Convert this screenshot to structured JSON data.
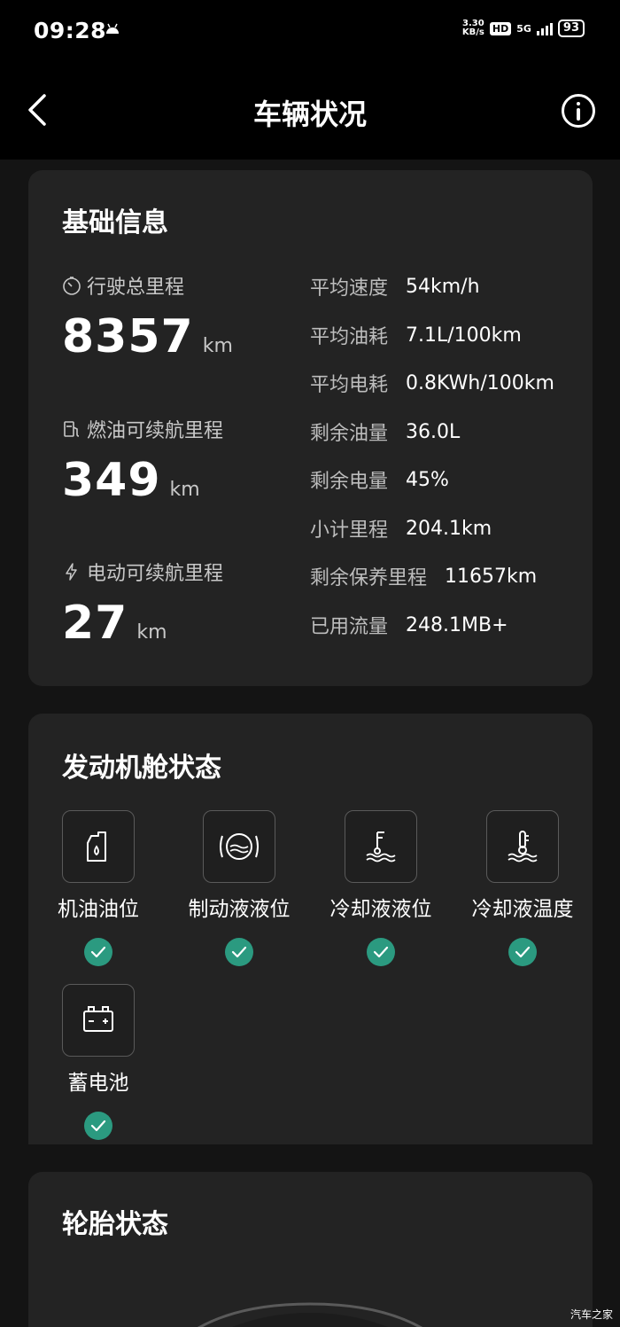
{
  "status_bar": {
    "time": "09:28",
    "net_speed_value": "3.30",
    "net_speed_unit": "KB/s",
    "hd_badge": "HD",
    "network": "5G",
    "battery": "93"
  },
  "nav": {
    "title": "车辆状况",
    "back_icon": "chevron-left-icon",
    "info_icon": "info-circle-icon"
  },
  "basic_info": {
    "title": "基础信息",
    "total_mileage": {
      "label": "行驶总里程",
      "value": "8357",
      "unit": "km"
    },
    "fuel_range": {
      "label": "燃油可续航里程",
      "value": "349",
      "unit": "km"
    },
    "electric_range": {
      "label": "电动可续航里程",
      "value": "27",
      "unit": "km"
    },
    "stats": [
      {
        "label": "平均速度",
        "value": "54km/h"
      },
      {
        "label": "平均油耗",
        "value": "7.1L/100km"
      },
      {
        "label": "平均电耗",
        "value": "0.8KWh/100km"
      },
      {
        "label": "剩余油量",
        "value": "36.0L"
      },
      {
        "label": "剩余电量",
        "value": "45%"
      },
      {
        "label": "小计里程",
        "value": "204.1km"
      },
      {
        "label": "剩余保养里程",
        "value": "11657km"
      },
      {
        "label": "已用流量",
        "value": "248.1MB+"
      }
    ]
  },
  "engine": {
    "title": "发动机舱状态",
    "items": [
      {
        "label": "机油油位",
        "icon": "oil-can-icon",
        "status": "ok"
      },
      {
        "label": "制动液液位",
        "icon": "brake-fluid-icon",
        "status": "ok"
      },
      {
        "label": "冷却液液位",
        "icon": "coolant-level-icon",
        "status": "ok"
      },
      {
        "label": "冷却液温度",
        "icon": "coolant-temp-icon",
        "status": "ok"
      },
      {
        "label": "蓄电池",
        "icon": "battery-icon",
        "status": "ok"
      }
    ]
  },
  "tire": {
    "title": "轮胎状态"
  },
  "watermark": "汽车之家",
  "colors": {
    "background": "#141414",
    "card": "#232323",
    "ok_badge": "#2b9a80"
  }
}
